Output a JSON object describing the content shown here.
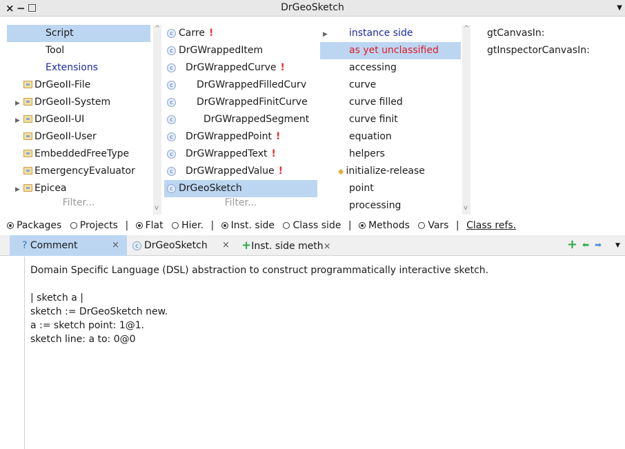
{
  "window": {
    "title": "DrGeoSketch"
  },
  "packages": {
    "items": [
      {
        "label": "Script",
        "kind": "plain",
        "selected": true,
        "color": "normal"
      },
      {
        "label": "Tool",
        "kind": "plain",
        "color": "normal"
      },
      {
        "label": "Extensions",
        "kind": "plain",
        "color": "blue"
      },
      {
        "label": "DrGeoII-File",
        "kind": "pkg",
        "expandable": false
      },
      {
        "label": "DrGeoII-System",
        "kind": "pkg",
        "expandable": true
      },
      {
        "label": "DrGeoII-UI",
        "kind": "pkg",
        "expandable": true
      },
      {
        "label": "DrGeoII-User",
        "kind": "pkg",
        "expandable": false
      },
      {
        "label": "EmbeddedFreeType",
        "kind": "pkg",
        "expandable": false
      },
      {
        "label": "EmergencyEvaluator",
        "kind": "pkg",
        "expandable": false
      },
      {
        "label": "Epicea",
        "kind": "pkg",
        "expandable": true
      }
    ],
    "filter_placeholder": "Filter..."
  },
  "classes": {
    "items": [
      {
        "label": "Carre",
        "warning": "!"
      },
      {
        "label": "DrGWrappedItem"
      },
      {
        "label": "DrGWrappedCurve",
        "warning": "!"
      },
      {
        "label": "DrGWrappedFilledCurv"
      },
      {
        "label": "DrGWrappedFinitCurve"
      },
      {
        "label": "DrGWrappedSegment"
      },
      {
        "label": "DrGWrappedPoint",
        "warning": "!"
      },
      {
        "label": "DrGWrappedText",
        "warning": "!"
      },
      {
        "label": "DrGWrappedValue",
        "warning": "!"
      },
      {
        "label": "DrGeoSketch",
        "selected": true
      }
    ],
    "filter_placeholder": "Filter..."
  },
  "protocols": {
    "items": [
      {
        "label": "instance side",
        "color": "blue",
        "arrow": true
      },
      {
        "label": "as yet unclassified",
        "color": "red",
        "selected": true
      },
      {
        "label": "accessing"
      },
      {
        "label": "curve"
      },
      {
        "label": "curve filled"
      },
      {
        "label": "curve finit"
      },
      {
        "label": "equation"
      },
      {
        "label": "helpers"
      },
      {
        "label": "initialize-release",
        "marker": true
      },
      {
        "label": "point"
      },
      {
        "label": "processing"
      }
    ]
  },
  "methods": {
    "items": [
      {
        "label": "gtCanvasIn:"
      },
      {
        "label": "gtInspectorCanvasIn:"
      }
    ]
  },
  "radio_bar": {
    "packages": "Packages",
    "projects": "Projects",
    "flat": "Flat",
    "hier": "Hier.",
    "inst_side": "Inst. side",
    "class_side": "Class side",
    "methods": "Methods",
    "vars": "Vars",
    "class_refs": "Class refs.",
    "sep": "|"
  },
  "tabs": [
    {
      "label": "Comment",
      "prefix": "?"
    },
    {
      "label": "DrGeoSketch",
      "prefix": "c"
    },
    {
      "label": "Inst. side meth",
      "prefix": "+"
    }
  ],
  "tab_close": "×",
  "comment": {
    "line1": "Domain Specific Language (DSL) abstraction to construct programmatically interactive sketch.",
    "line2": "",
    "line3": "| sketch a |",
    "line4": "sketch := DrGeoSketch new.",
    "line5": "a := sketch point: 1@1.",
    "line6": "sketch line: a to: 0@0"
  },
  "icons": {
    "close": "×",
    "minimize": "−",
    "maximize": "□",
    "menu": "▼",
    "add": "+",
    "back": "⬅",
    "forward": "➡",
    "expand": "▶",
    "warning": "!"
  },
  "colors": {
    "selection": "#bcd6f2",
    "warning": "#e23030",
    "blue_text": "#1c2a9e",
    "red_text": "#e01b24",
    "add_green": "#2ea84a"
  }
}
